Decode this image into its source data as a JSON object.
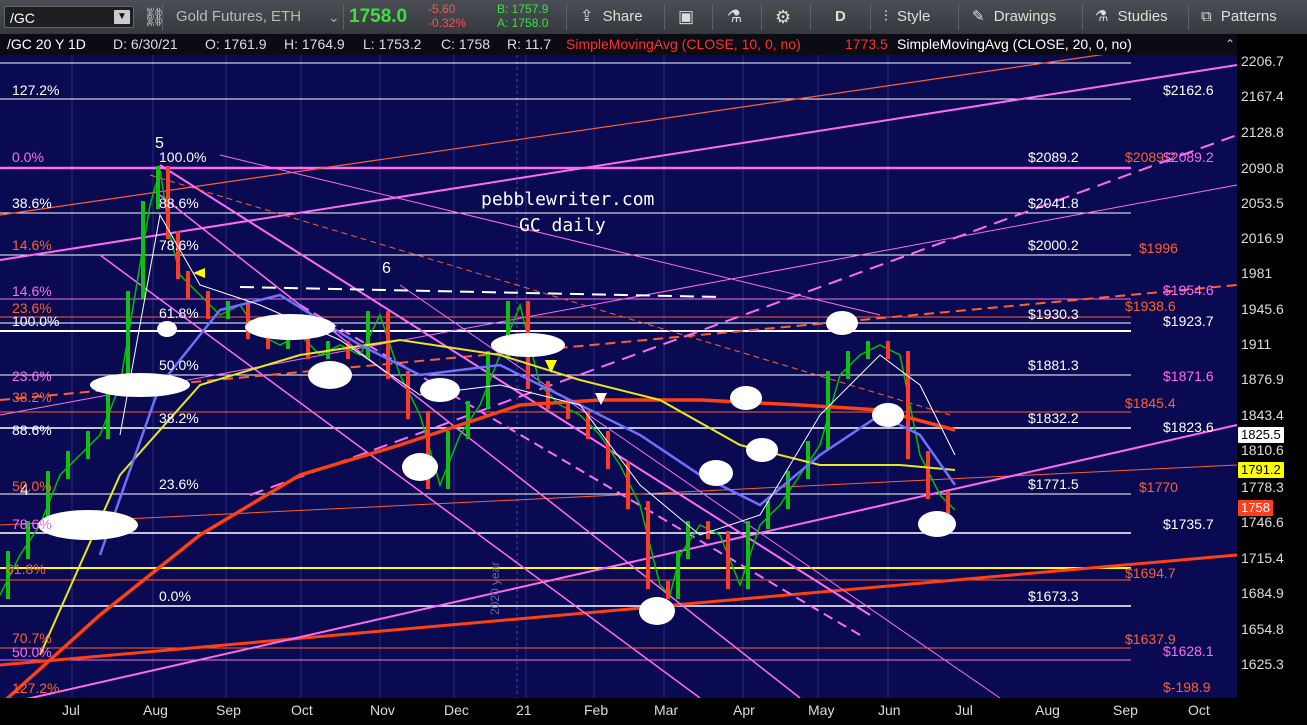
{
  "toolbar": {
    "symbol": "/GC",
    "description": "Gold Futures, ETH",
    "change": "-5.60",
    "change_pct": "-0.32%",
    "bid": "B: 1757.9",
    "ask": "A: 1758.0",
    "last": "1758.0",
    "share": "Share",
    "style": "Style",
    "drawings": "Drawings",
    "studies": "Studies",
    "patterns": "Patterns",
    "period": "D",
    "colors": {
      "up": "#3ee03e",
      "down": "#ff4a4a",
      "bg": "#3f4348"
    }
  },
  "infobar": {
    "title": "/GC 20 Y 1D",
    "date": "D: 6/30/21",
    "open": "O: 1761.9",
    "high": "H: 1764.9",
    "low": "L: 1753.2",
    "close": "C: 1758",
    "range": "R: 11.7",
    "sma10": "SimpleMovingAvg (CLOSE, 10, 0, no)",
    "sma10_value": "1773.5",
    "sma20": "SimpleMovingAvg (CLOSE, 20, 0, no)"
  },
  "chart": {
    "watermark": "pebblewriter.com",
    "subtitle": "GC daily",
    "year_label": "2020 year",
    "wave_5": "5",
    "wave_6": "6",
    "wave_4": "4"
  },
  "fib_left": [
    {
      "t": "127.2%",
      "c": "#ffffff"
    },
    {
      "t": "0.0%",
      "c": "#ff6cf0"
    },
    {
      "t": "38.6%",
      "c": "#ffffff"
    },
    {
      "t": "14.6%",
      "c": "#ff6030"
    },
    {
      "t": "14.6%",
      "c": "#ff6cf0"
    },
    {
      "t": "23.6%",
      "c": "#ff6030"
    },
    {
      "t": "100.0%",
      "c": "#ffffff"
    },
    {
      "t": "23.6%",
      "c": "#ff6cf0"
    },
    {
      "t": "38.2%",
      "c": "#ff6030"
    },
    {
      "t": "88.6%",
      "c": "#ffffff"
    },
    {
      "t": "50.0%",
      "c": "#ff6030"
    },
    {
      "t": "78.6%",
      "c": "#ff6cf0"
    },
    {
      "t": "61.8%",
      "c": "#ff6030"
    },
    {
      "t": "70.7%",
      "c": "#ff6030"
    },
    {
      "t": "50.0%",
      "c": "#ff6cf0"
    },
    {
      "t": "127.2%",
      "c": "#ff6030"
    }
  ],
  "fib_mid": [
    {
      "t": "100.0%",
      "c": "#ffffff"
    },
    {
      "t": "88.6%",
      "c": "#ffffff"
    },
    {
      "t": "78.6%",
      "c": "#ffffff"
    },
    {
      "t": "61.8%",
      "c": "#ffffff"
    },
    {
      "t": "50.0%",
      "c": "#ffffff"
    },
    {
      "t": "38.2%",
      "c": "#ffffff"
    },
    {
      "t": "23.6%",
      "c": "#ffffff"
    },
    {
      "t": "0.0%",
      "c": "#ffffff"
    }
  ],
  "price_labels": [
    {
      "t": "$2162.6",
      "c": "#ffffff"
    },
    {
      "t": "$2089.2",
      "c": "#ffffff"
    },
    {
      "t": "$2089.2",
      "c": "#ff6030"
    },
    {
      "t": "$2089.2",
      "c": "#ff6cf0"
    },
    {
      "t": "$2041.8",
      "c": "#ffffff"
    },
    {
      "t": "$2000.2",
      "c": "#ffffff"
    },
    {
      "t": "$1996",
      "c": "#ff6030"
    },
    {
      "t": "$1954.6",
      "c": "#ff6cf0"
    },
    {
      "t": "$1938.6",
      "c": "#ff6030"
    },
    {
      "t": "$1930.3",
      "c": "#ffffff"
    },
    {
      "t": "$1923.7",
      "c": "#ffffff"
    },
    {
      "t": "$1881.3",
      "c": "#ffffff"
    },
    {
      "t": "$1871.6",
      "c": "#ff6cf0"
    },
    {
      "t": "$1845.4",
      "c": "#ff6030"
    },
    {
      "t": "$1832.2",
      "c": "#ffffff"
    },
    {
      "t": "$1823.6",
      "c": "#ffffff"
    },
    {
      "t": "$1771.5",
      "c": "#ffffff"
    },
    {
      "t": "$1770",
      "c": "#ff6030"
    },
    {
      "t": "$1735.7",
      "c": "#ffffff"
    },
    {
      "t": "$1694.7",
      "c": "#ff6030"
    },
    {
      "t": "$1673.3",
      "c": "#ffffff"
    },
    {
      "t": "$1637.9",
      "c": "#ff6030"
    },
    {
      "t": "$1628.1",
      "c": "#ff6cf0"
    },
    {
      "t": "$-198.9",
      "c": "#ff6030"
    }
  ],
  "yaxis": {
    "ticks": [
      "2206.7",
      "2167.4",
      "2128.8",
      "2090.8",
      "2053.5",
      "2016.9",
      "1981",
      "1945.6",
      "1911",
      "1876.9",
      "1843.4",
      "1810.6",
      "1778.3",
      "1746.6",
      "1715.4",
      "1684.9",
      "1654.8",
      "1625.3"
    ],
    "flags": [
      {
        "t": "1825.5",
        "bg": "#ffffff",
        "fg": "#000000"
      },
      {
        "t": "1791.2",
        "bg": "#ffff00",
        "fg": "#000000"
      },
      {
        "t": "1758",
        "bg": "#ff4020",
        "fg": "#ffffff"
      }
    ]
  },
  "xaxis": {
    "months": [
      "Jul",
      "Aug",
      "Sep",
      "Oct",
      "Nov",
      "Dec",
      "21",
      "Feb",
      "Mar",
      "Apr",
      "May",
      "Jun",
      "Jul",
      "Aug",
      "Sep",
      "Oct"
    ]
  }
}
